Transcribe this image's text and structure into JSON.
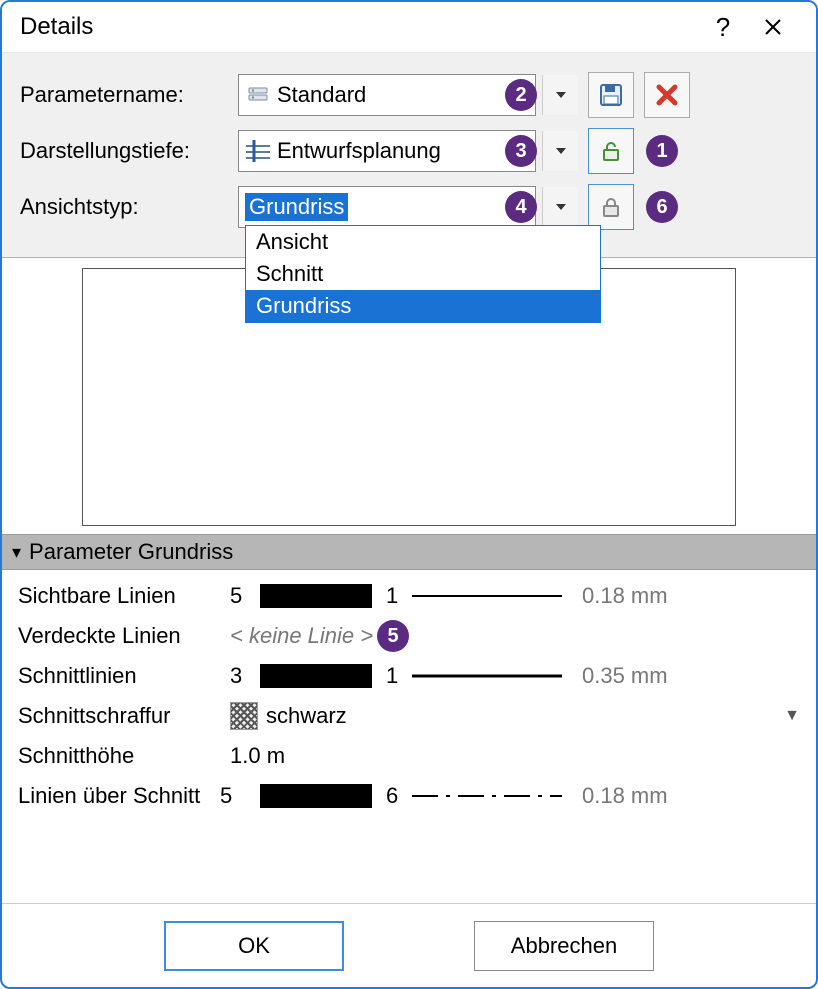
{
  "window": {
    "title": "Details"
  },
  "badges": {
    "b1": "1",
    "b2": "2",
    "b3": "3",
    "b4": "4",
    "b5": "5",
    "b6": "6"
  },
  "form": {
    "parametername": {
      "label": "Parametername:",
      "value": "Standard"
    },
    "darstellungstiefe": {
      "label": "Darstellungstiefe:",
      "value": "Entwurfsplanung"
    },
    "ansichtstyp": {
      "label": "Ansichtstyp:",
      "value": "Grundriss",
      "options": [
        "Ansicht",
        "Schnitt",
        "Grundriss"
      ]
    }
  },
  "section": {
    "title": "Parameter Grundriss"
  },
  "params": {
    "sichtbare": {
      "label": "Sichtbare Linien",
      "v1": "5",
      "v2": "1",
      "dim": "0.18 mm"
    },
    "verdeckte": {
      "label": "Verdeckte Linien",
      "placeholder": "< keine Linie >"
    },
    "schnittlinien": {
      "label": "Schnittlinien",
      "v1": "3",
      "v2": "1",
      "dim": "0.35 mm"
    },
    "schraffur": {
      "label": "Schnittschraffur",
      "value": "schwarz"
    },
    "hoehe": {
      "label": "Schnitthöhe",
      "value": "1.0 m"
    },
    "ueber": {
      "label": "Linien über Schnitt",
      "v1": "5",
      "v2": "6",
      "dim": "0.18 mm"
    }
  },
  "buttons": {
    "ok": "OK",
    "cancel": "Abbrechen"
  }
}
